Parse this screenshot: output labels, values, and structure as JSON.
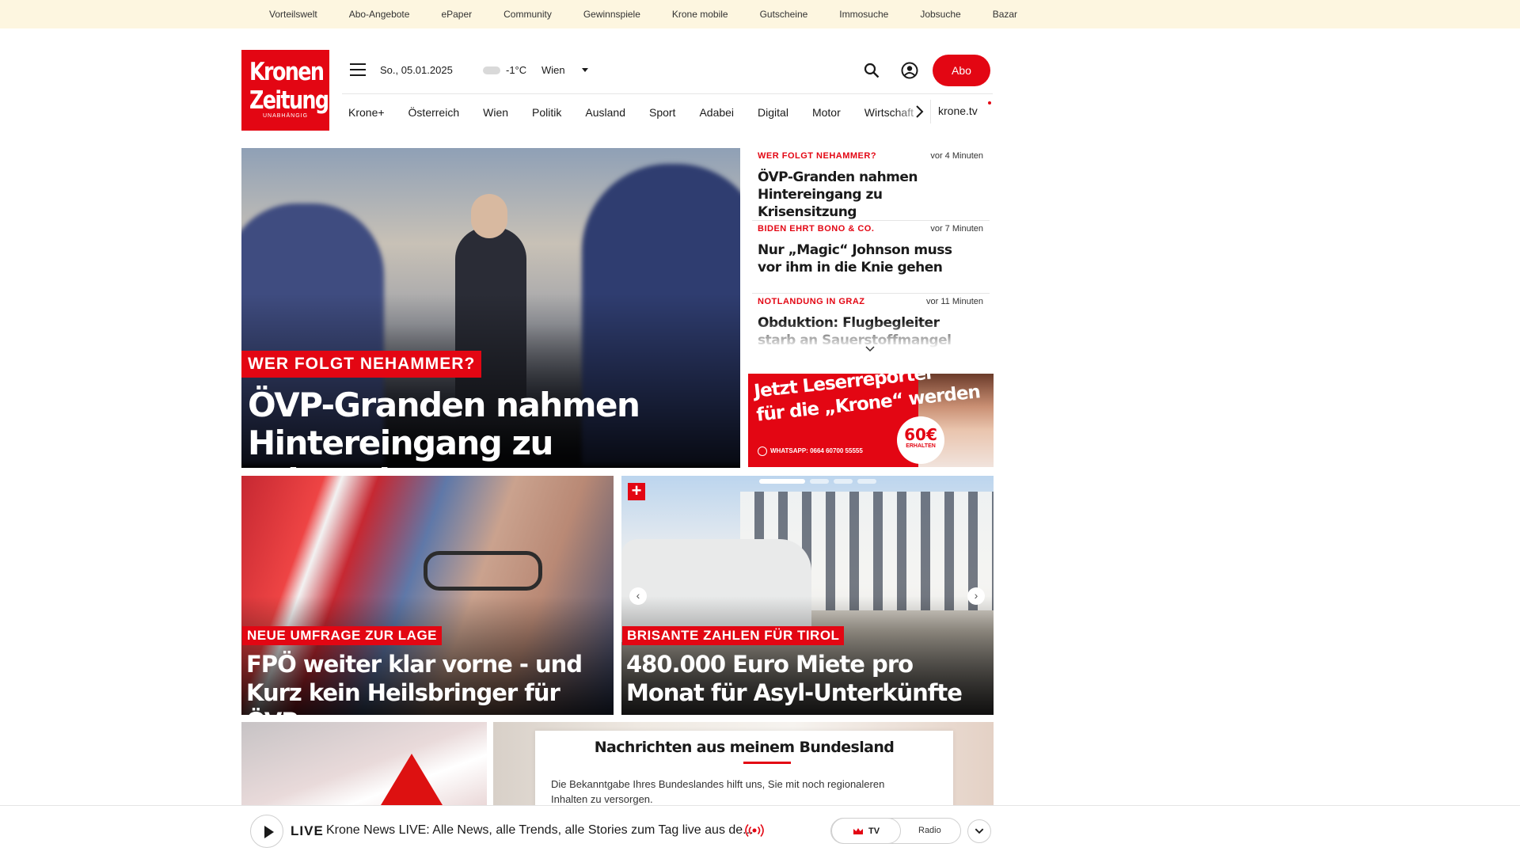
{
  "topbar": {
    "links": [
      "Vorteilswelt",
      "Abo-Angebote",
      "ePaper",
      "Community",
      "Gewinnspiele",
      "Krone mobile",
      "Gutscheine",
      "Immosuche",
      "Jobsuche",
      "Bazar"
    ]
  },
  "header": {
    "logo_line1": "Kronen",
    "logo_line2": "Zeitung",
    "logo_line3": "UNABHÄNGIG",
    "date": "So., 05.01.2025",
    "weather_icon": "cloud-icon",
    "temperature": "-1°C",
    "city": "Wien",
    "abo_label": "Abo"
  },
  "nav": {
    "items": [
      "Krone+",
      "Österreich",
      "Wien",
      "Politik",
      "Ausland",
      "Sport",
      "Adabei",
      "Digital",
      "Motor",
      "Wirtschaft"
    ],
    "tv_label": "krone.tv"
  },
  "hero": {
    "kicker": "WER FOLGT NEHAMMER?",
    "title": "ÖVP-Granden nahmen Hintereingang zu Krisensitzung"
  },
  "ticker": [
    {
      "kicker": "WER FOLGT NEHAMMER?",
      "time": "vor 4 Minuten",
      "title": "ÖVP-Granden nahmen Hintereingang zu Krisensitzung"
    },
    {
      "kicker": "BIDEN EHRT BONO & CO.",
      "time": "vor 7 Minuten",
      "title": "Nur „Magic“ Johnson muss vor ihm in die Knie gehen"
    },
    {
      "kicker": "NOTLANDUNG IN GRAZ",
      "time": "vor 11 Minuten",
      "title": "Obduktion: Flugbegleiter starb an Sauerstoffmangel"
    }
  ],
  "ad": {
    "line1": "Jetzt Leserreporter",
    "line2": "für die „Krone“ werden",
    "whatsapp": "WHATSAPP: 0664 60700 55555",
    "badge_amount": "60€",
    "badge_label": "ERHALTEN"
  },
  "cards": [
    {
      "kicker": "NEUE UMFRAGE ZUR LAGE",
      "title": "FPÖ weiter klar vorne - und Kurz kein Heilsbringer für ÖVP"
    },
    {
      "kicker": "BRISANTE ZAHLEN FÜR TIROL",
      "title": "480.000 Euro Miete pro Monat für Asyl-Unterkünfte",
      "plus": "+"
    }
  ],
  "bundesland": {
    "heading": "Nachrichten aus meinem Bundesland",
    "text": "Die Bekanntgabe Ihres Bundeslandes hilft uns, Sie mit noch regionaleren Inhalten zu versorgen."
  },
  "livebar": {
    "label": "LIVE",
    "text": "Krone News LIVE: Alle News, alle Trends, alle Stories zum Tag live aus de...",
    "tv": "TV",
    "radio": "Radio"
  },
  "colors": {
    "brand_red": "#e30613",
    "topbar_bg": "#fdf6e0"
  }
}
